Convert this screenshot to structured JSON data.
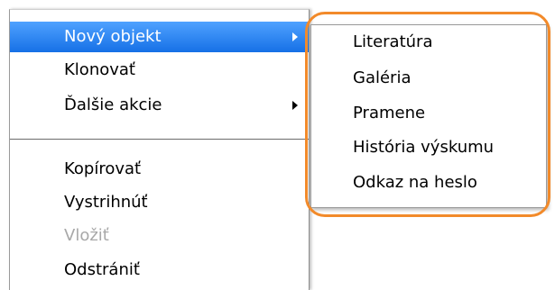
{
  "menu": {
    "items": [
      {
        "label": "Nový objekt",
        "has_submenu": true,
        "highlighted": true,
        "disabled": false
      },
      {
        "label": "Klonovať",
        "has_submenu": false,
        "highlighted": false,
        "disabled": false
      },
      {
        "label": "Ďalšie akcie",
        "has_submenu": true,
        "highlighted": false,
        "disabled": false
      },
      {
        "label": "Kopírovať",
        "has_submenu": false,
        "highlighted": false,
        "disabled": false
      },
      {
        "label": "Vystrihnúť",
        "has_submenu": false,
        "highlighted": false,
        "disabled": false
      },
      {
        "label": "Vložiť",
        "has_submenu": false,
        "highlighted": false,
        "disabled": true
      },
      {
        "label": "Odstrániť",
        "has_submenu": false,
        "highlighted": false,
        "disabled": false
      }
    ]
  },
  "submenu": {
    "items": [
      {
        "label": "Literatúra"
      },
      {
        "label": "Galéria"
      },
      {
        "label": "Pramene"
      },
      {
        "label": "História výskumu"
      },
      {
        "label": "Odkaz na heslo"
      }
    ]
  },
  "colors": {
    "highlight": "#1670e6",
    "annotation_ring": "#f28a2a",
    "disabled_text": "#a8a8a8"
  },
  "icons": {
    "submenu_arrow": "chevron-right-icon"
  }
}
